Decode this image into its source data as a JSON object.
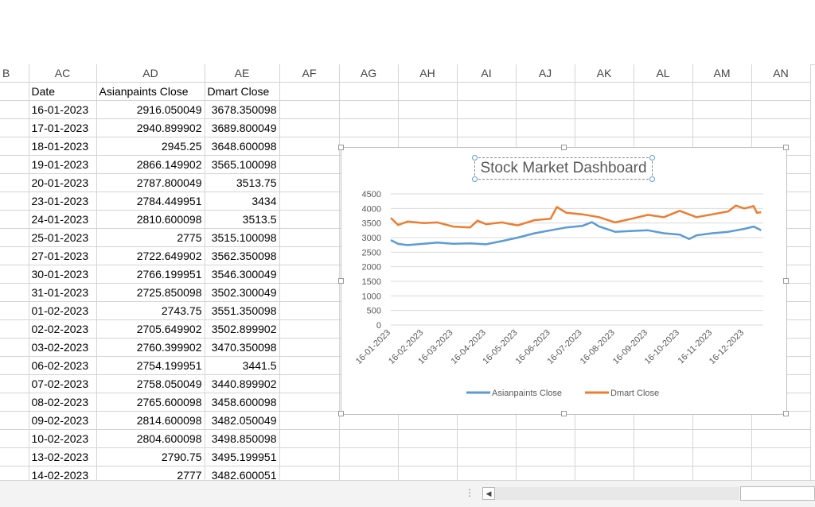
{
  "columns": [
    "B",
    "AC",
    "AD",
    "AE",
    "AF",
    "AG",
    "AH",
    "AI",
    "AJ",
    "AK",
    "AL",
    "AM",
    "AN"
  ],
  "table": {
    "headers": [
      "Date",
      "Asianpaints Close",
      "Dmart Close"
    ],
    "rows": [
      [
        "16-01-2023",
        "2916.050049",
        "3678.350098"
      ],
      [
        "17-01-2023",
        "2940.899902",
        "3689.800049"
      ],
      [
        "18-01-2023",
        "2945.25",
        "3648.600098"
      ],
      [
        "19-01-2023",
        "2866.149902",
        "3565.100098"
      ],
      [
        "20-01-2023",
        "2787.800049",
        "3513.75"
      ],
      [
        "23-01-2023",
        "2784.449951",
        "3434"
      ],
      [
        "24-01-2023",
        "2810.600098",
        "3513.5"
      ],
      [
        "25-01-2023",
        "2775",
        "3515.100098"
      ],
      [
        "27-01-2023",
        "2722.649902",
        "3562.350098"
      ],
      [
        "30-01-2023",
        "2766.199951",
        "3546.300049"
      ],
      [
        "31-01-2023",
        "2725.850098",
        "3502.300049"
      ],
      [
        "01-02-2023",
        "2743.75",
        "3551.350098"
      ],
      [
        "02-02-2023",
        "2705.649902",
        "3502.899902"
      ],
      [
        "03-02-2023",
        "2760.399902",
        "3470.350098"
      ],
      [
        "06-02-2023",
        "2754.199951",
        "3441.5"
      ],
      [
        "07-02-2023",
        "2758.050049",
        "3440.899902"
      ],
      [
        "08-02-2023",
        "2765.600098",
        "3458.600098"
      ],
      [
        "09-02-2023",
        "2814.600098",
        "3482.050049"
      ],
      [
        "10-02-2023",
        "2804.600098",
        "3498.850098"
      ],
      [
        "13-02-2023",
        "2790.75",
        "3495.199951"
      ],
      [
        "14-02-2023",
        "2777",
        "3482.600051"
      ]
    ]
  },
  "chart": {
    "title": "Stock Market Dashboard",
    "legend": [
      "Asianpaints Close",
      "Dmart Close"
    ],
    "colors": {
      "asianpaints": "#5b9bd5",
      "dmart": "#ed7d31"
    }
  },
  "chart_data": {
    "type": "line",
    "title": "Stock Market Dashboard",
    "xlabel": "",
    "ylabel": "",
    "ylim": [
      0,
      4500
    ],
    "yticks": [
      0,
      500,
      1000,
      1500,
      2000,
      2500,
      3000,
      3500,
      4000,
      4500
    ],
    "xticks": [
      "16-01-2023",
      "16-02-2023",
      "16-03-2023",
      "16-04-2023",
      "16-05-2023",
      "16-06-2023",
      "16-07-2023",
      "16-08-2023",
      "16-09-2023",
      "16-10-2023",
      "16-11-2023",
      "16-12-2023"
    ],
    "grid": true,
    "legend_position": "bottom",
    "series": [
      {
        "name": "Asianpaints Close",
        "color": "#5b9bd5",
        "points": [
          [
            "16-01-2023",
            2916
          ],
          [
            "23-01-2023",
            2784
          ],
          [
            "01-02-2023",
            2744
          ],
          [
            "16-02-2023",
            2790
          ],
          [
            "01-03-2023",
            2830
          ],
          [
            "16-03-2023",
            2790
          ],
          [
            "01-04-2023",
            2800
          ],
          [
            "16-04-2023",
            2770
          ],
          [
            "01-05-2023",
            2880
          ],
          [
            "16-05-2023",
            3000
          ],
          [
            "01-06-2023",
            3150
          ],
          [
            "16-06-2023",
            3250
          ],
          [
            "01-07-2023",
            3350
          ],
          [
            "16-07-2023",
            3400
          ],
          [
            "25-07-2023",
            3530
          ],
          [
            "01-08-2023",
            3380
          ],
          [
            "16-08-2023",
            3200
          ],
          [
            "01-09-2023",
            3230
          ],
          [
            "16-09-2023",
            3250
          ],
          [
            "01-10-2023",
            3150
          ],
          [
            "16-10-2023",
            3100
          ],
          [
            "25-10-2023",
            2950
          ],
          [
            "01-11-2023",
            3080
          ],
          [
            "16-11-2023",
            3150
          ],
          [
            "01-12-2023",
            3200
          ],
          [
            "16-12-2023",
            3300
          ],
          [
            "25-12-2023",
            3380
          ],
          [
            "01-01-2024",
            3250
          ]
        ]
      },
      {
        "name": "Dmart Close",
        "color": "#ed7d31",
        "points": [
          [
            "16-01-2023",
            3678
          ],
          [
            "23-01-2023",
            3434
          ],
          [
            "01-02-2023",
            3551
          ],
          [
            "16-02-2023",
            3495
          ],
          [
            "01-03-2023",
            3520
          ],
          [
            "16-03-2023",
            3380
          ],
          [
            "01-04-2023",
            3350
          ],
          [
            "08-04-2023",
            3580
          ],
          [
            "16-04-2023",
            3460
          ],
          [
            "01-05-2023",
            3520
          ],
          [
            "16-05-2023",
            3420
          ],
          [
            "01-06-2023",
            3600
          ],
          [
            "16-06-2023",
            3650
          ],
          [
            "22-06-2023",
            4050
          ],
          [
            "01-07-2023",
            3850
          ],
          [
            "16-07-2023",
            3800
          ],
          [
            "01-08-2023",
            3700
          ],
          [
            "16-08-2023",
            3520
          ],
          [
            "01-09-2023",
            3650
          ],
          [
            "16-09-2023",
            3780
          ],
          [
            "01-10-2023",
            3700
          ],
          [
            "16-10-2023",
            3920
          ],
          [
            "01-11-2023",
            3700
          ],
          [
            "16-11-2023",
            3800
          ],
          [
            "01-12-2023",
            3900
          ],
          [
            "08-12-2023",
            4100
          ],
          [
            "16-12-2023",
            4000
          ],
          [
            "25-12-2023",
            4080
          ],
          [
            "28-12-2023",
            3850
          ],
          [
            "01-01-2024",
            3870
          ]
        ]
      }
    ]
  }
}
